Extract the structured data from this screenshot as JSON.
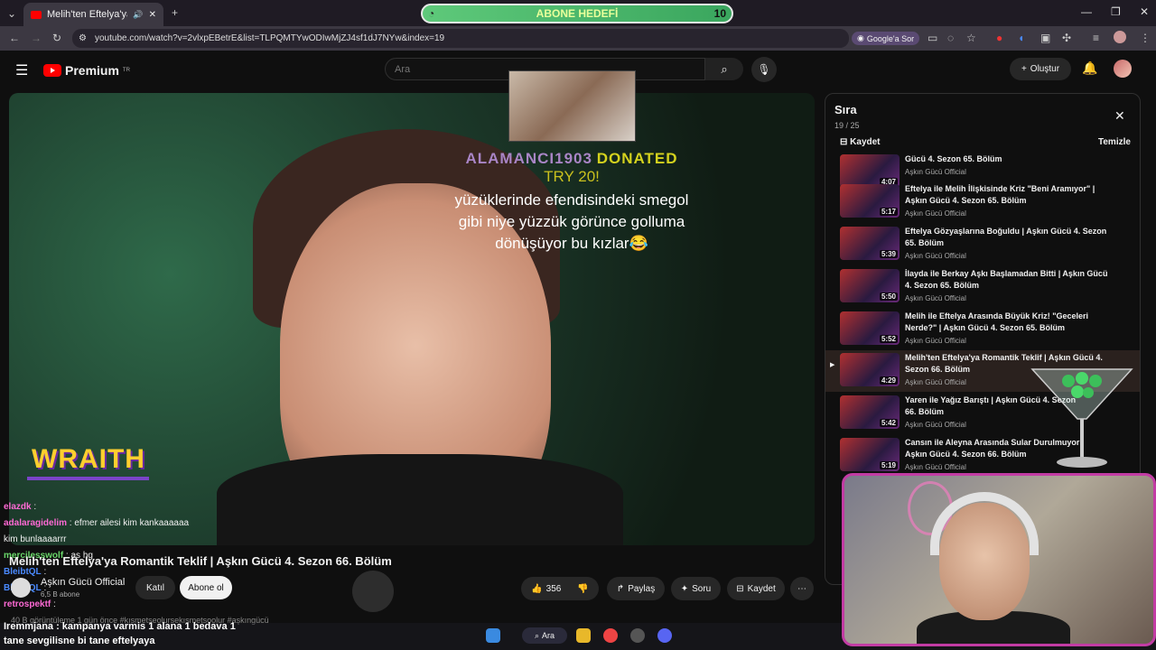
{
  "browser": {
    "tab_title": "Melih'ten Eftelya'ya Romantik",
    "url": "youtube.com/watch?v=2vlxpEBetrE&list=TLPQMTYwODIwMjZJ4sf1dJ7NYw&index=19",
    "ask_google": "Google'a Sor",
    "goal": {
      "label": "ABONE HEDEFİ",
      "value": "10"
    }
  },
  "youtube": {
    "logo": "Premium",
    "logo_region": "TR",
    "search_placeholder": "Ara",
    "create_label": "Oluştur"
  },
  "overlay": {
    "donor": "ALAMANCI1903",
    "donated": "DONATED",
    "amount": "TRY 20!",
    "message": "yüzüklerinde efendisindeki smegol gibi niye yüzzük görünce golluma dönüşüyor bu kızlar😂",
    "wraith": "WRAITH"
  },
  "chat": [
    {
      "user": "elazdk",
      "text": "",
      "color": "#ff6ad5"
    },
    {
      "user": "adalaragidelim",
      "text": "efmer ailesi kim kankaaaaaa",
      "color": "#ff6ad5"
    },
    {
      "user": "",
      "text": "kim bunlaaaarrr",
      "color": "#ffffff"
    },
    {
      "user": "mercilesswolf",
      "text": "as hg",
      "color": "#6ad86a"
    },
    {
      "user": "BleibtQL",
      "text": "",
      "color": "#4a8aff"
    },
    {
      "user": "BleibtQL",
      "text": "",
      "color": "#4a8aff"
    },
    {
      "user": "retrospektf",
      "text": "",
      "color": "#ff6ad5"
    }
  ],
  "bottom_chat": [
    "Iremmjana : kampanya varmis 1 alana 1 bedava 1",
    "tane sevgilisne bi tane eftelyaya"
  ],
  "video": {
    "title": "Melih'ten Eftelya'ya Romantik Teklif | Aşkın Gücü 4. Sezon 66. Bölüm",
    "channel": "Aşkın Gücü Official",
    "subs": "6,5 B abone",
    "join": "Katıl",
    "subscribe": "Abone ol",
    "likes": "356",
    "share": "Paylaş",
    "ask": "Soru",
    "save": "Kaydet",
    "desc": "40 B görüntüleme  1 gün önce  #kısmetseolursekısmetsoolur #aşkıngücü"
  },
  "queue": {
    "title": "Sıra",
    "count": "19 / 25",
    "save": "Kaydet",
    "clear": "Temizle",
    "items": [
      {
        "title": "Gücü 4. Sezon 65. Bölüm",
        "channel": "Aşkın Gücü Official",
        "duration": "4:07"
      },
      {
        "title": "Eftelya ile Melih İlişkisinde Kriz \"Beni Aramıyor\" | Aşkın Gücü 4. Sezon 65. Bölüm",
        "channel": "Aşkın Gücü Official",
        "duration": "5:17"
      },
      {
        "title": "Eftelya Gözyaşlarına Boğuldu | Aşkın Gücü 4. Sezon 65. Bölüm",
        "channel": "Aşkın Gücü Official",
        "duration": "5:39"
      },
      {
        "title": "İlayda ile Berkay Aşkı Başlamadan Bitti | Aşkın Gücü 4. Sezon 65. Bölüm",
        "channel": "Aşkın Gücü Official",
        "duration": "5:50"
      },
      {
        "title": "Melih ile Eftelya Arasında Büyük Kriz! \"Geceleri Nerde?\" | Aşkın Gücü 4. Sezon 65. Bölüm",
        "channel": "Aşkın Gücü Official",
        "duration": "5:52"
      },
      {
        "title": "Melih'ten Eftelya'ya Romantik Teklif | Aşkın Gücü 4. Sezon 66. Bölüm",
        "channel": "Aşkın Gücü Official",
        "duration": "4:29"
      },
      {
        "title": "Yaren ile Yağız Barıştı | Aşkın Gücü 4. Sezon 66. Bölüm",
        "channel": "Aşkın Gücü Official",
        "duration": "5:42"
      },
      {
        "title": "Cansın ile Aleyna Arasında Sular Durulmuyor | Aşkın Gücü 4. Sezon 66. Bölüm",
        "channel": "Aşkın Gücü Official",
        "duration": "5:19"
      }
    ]
  },
  "taskbar": {
    "search": "Ara"
  }
}
